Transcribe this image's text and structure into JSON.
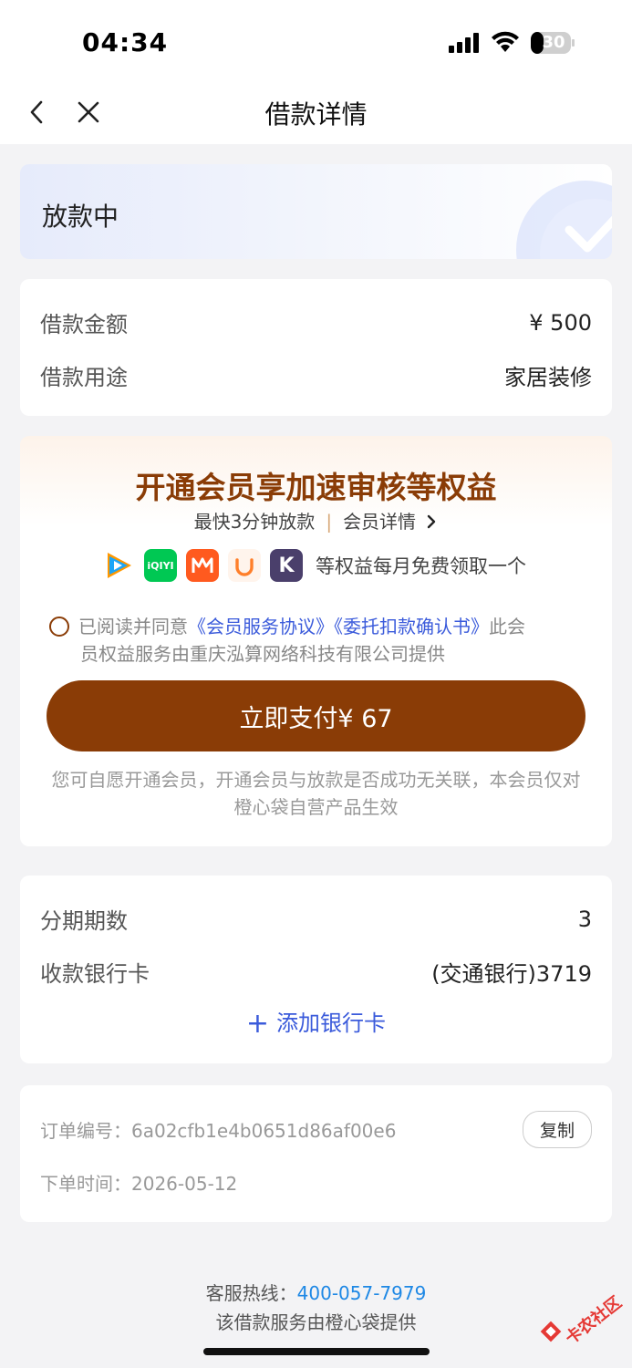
{
  "status_bar": {
    "time": "04:34",
    "battery": "30"
  },
  "nav": {
    "title": "借款详情"
  },
  "loan_status": {
    "text": "放款中"
  },
  "amount": {
    "amount_label": "借款金额",
    "amount_value": "¥ 500",
    "purpose_label": "借款用途",
    "purpose_value": "家居装修"
  },
  "member": {
    "title": "开通会员享加速审核等权益",
    "sub_left": "最快3分钟放款",
    "sub_right": "会员详情",
    "apps": [
      {
        "name": "tencent-video",
        "color": "#1ca5f7"
      },
      {
        "name": "iqiyi",
        "color": "#00c853",
        "label": "iQIYI"
      },
      {
        "name": "mgtv",
        "color": "#ff6a00"
      },
      {
        "name": "didi",
        "color": "#ff7f2a"
      },
      {
        "name": "kuaikan",
        "color": "#4a3f6b",
        "label": "K"
      }
    ],
    "apps_text": "等权益每月免费领取一个",
    "agree_prefix": "已阅读并同意",
    "agree_link1": "《会员服务协议》",
    "agree_link2": "《委托扣款确认书》",
    "agree_suffix1": "此会",
    "agree_suffix2": "员权益服务由重庆泓算网络科技有限公司提供",
    "pay_button": "立即支付¥ 67",
    "disclaimer": "您可自愿开通会员，开通会员与放款是否成功无关联，本会员仅对橙心袋自营产品生效"
  },
  "installment": {
    "periods_label": "分期期数",
    "periods_value": "3",
    "card_label": "收款银行卡",
    "card_value": "(交通银行)3719",
    "add_card": "添加银行卡"
  },
  "order": {
    "number_label": "订单编号：",
    "number_value": "6a02cfb1e4b0651d86af00e6",
    "copy_button": "复制",
    "time_label": "下单时间：",
    "time_value": "2026-05-12"
  },
  "footer": {
    "hotline_label": "客服热线：",
    "hotline_value": "400-057-7979",
    "provider": "该借款服务由橙心袋提供"
  },
  "watermark": {
    "text": "卡农社区"
  }
}
